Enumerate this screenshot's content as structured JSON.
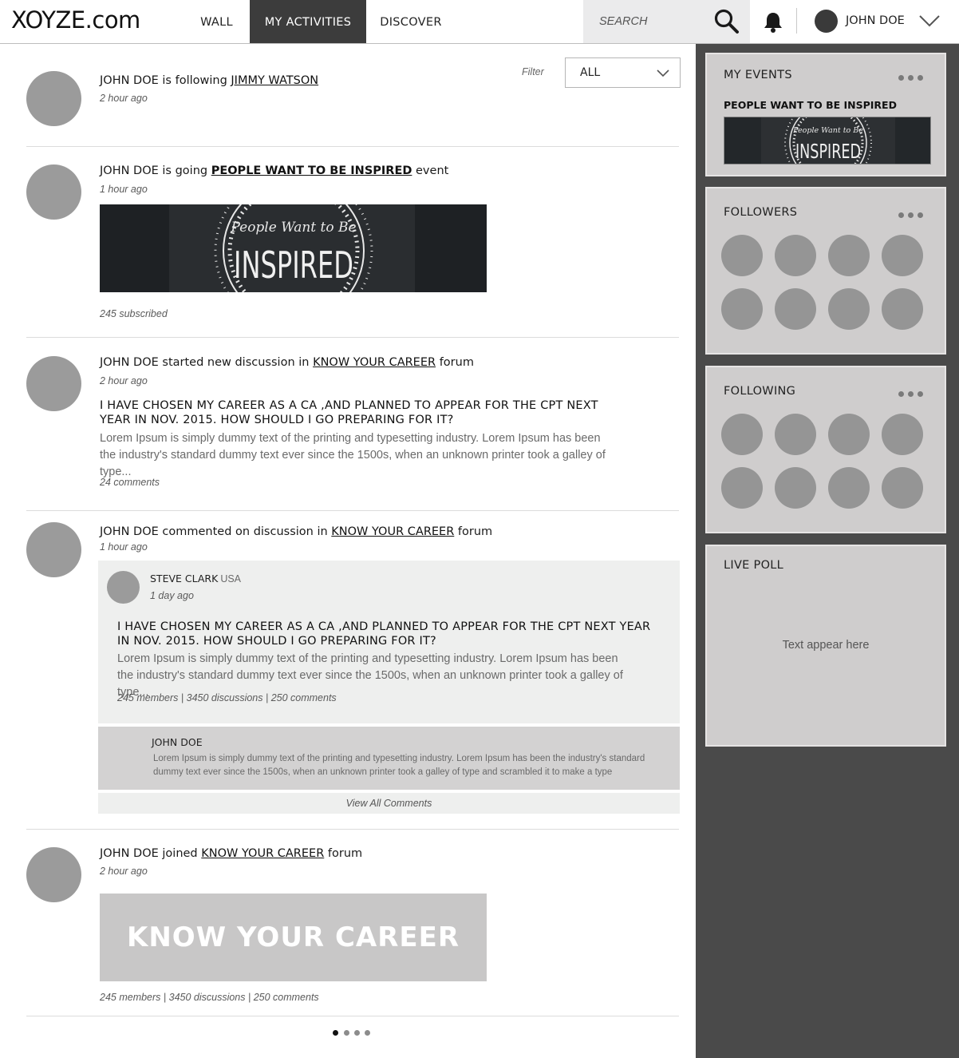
{
  "header": {
    "logo": "XOYZE.com",
    "nav": [
      "WALL",
      "MY ACTIVITIES",
      "DISCOVER"
    ],
    "active_nav": "MY ACTIVITIES",
    "search_placeholder": "SEARCH",
    "user_name": "JOHN DOE"
  },
  "filter": {
    "label": "Filter",
    "value": "ALL"
  },
  "feed": [
    {
      "prefix": "JOHN DOE is following ",
      "link": "JIMMY WATSON",
      "suffix": "",
      "time": "2 hour ago"
    },
    {
      "prefix": "JOHN DOE is going ",
      "link": "PEOPLE WANT TO BE INSPIRED",
      "suffix": " event",
      "time": "1 hour ago",
      "banner_script": "People Want to Be",
      "banner_word": "INSPIRED",
      "meta": "245 subscribed"
    },
    {
      "prefix": "JOHN DOE started new discussion in ",
      "link": "KNOW YOUR CAREER",
      "suffix": " forum",
      "time": "2 hour ago",
      "title": "I HAVE CHOSEN MY CAREER AS A CA ,AND PLANNED TO APPEAR FOR THE CPT NEXT YEAR IN NOV. 2015. HOW SHOULD I GO PREPARING FOR IT?",
      "body": "Lorem Ipsum is simply dummy text of the printing and typesetting industry. Lorem Ipsum has been the industry's standard dummy text ever since the 1500s, when an unknown printer took a galley of type...",
      "meta": "24 comments"
    },
    {
      "prefix": "JOHN DOE commented on discussion in ",
      "link": "KNOW YOUR CAREER",
      "suffix": " forum",
      "time": "1 hour ago",
      "comment": {
        "author": "STEVE CLARK",
        "country": "USA",
        "time": "1 day ago",
        "title": "I HAVE CHOSEN MY CAREER AS A CA ,AND PLANNED TO APPEAR FOR THE CPT NEXT YEAR IN NOV. 2015. HOW SHOULD I GO PREPARING FOR IT?",
        "body": "Lorem Ipsum is simply dummy text of the printing and typesetting industry. Lorem Ipsum has been the industry's standard dummy text ever since the 1500s, when an unknown printer took a galley of type...",
        "stats": "245 members  |  3450 discussions  |  250 comments"
      },
      "reply": {
        "author": "JOHN DOE",
        "body": "Lorem Ipsum is simply dummy text of the printing and typesetting industry. Lorem Ipsum has been the industry's standard dummy text ever since the 1500s, when an unknown printer took a galley of type and scrambled it to make a type"
      },
      "view_all": "View All Comments"
    },
    {
      "prefix": "JOHN DOE joined ",
      "link": "KNOW YOUR CAREER",
      "suffix": " forum",
      "time": "2 hour ago",
      "banner_text": "KNOW YOUR CAREER",
      "meta": "245 members  |  3450 discussions  |  250 comments"
    }
  ],
  "sidebar": {
    "events": {
      "title": "MY EVENTS",
      "event_name": "PEOPLE WANT TO BE INSPIRED",
      "banner_script": "People Want to Be",
      "banner_word": "INSPIRED"
    },
    "followers": {
      "title": "FOLLOWERS",
      "count_shown": 8
    },
    "following": {
      "title": "FOLLOWING",
      "count_shown": 8
    },
    "poll": {
      "title": "LIVE POLL",
      "placeholder": "Text appear here"
    }
  },
  "pagination": {
    "pages": 4,
    "active": 1
  },
  "colors": {
    "active_tab": "#3c3c3c",
    "sidebar_bg": "#4a4a4a",
    "widget_bg": "#cfcdcd",
    "avatar_placeholder": "#9b9b9b"
  }
}
